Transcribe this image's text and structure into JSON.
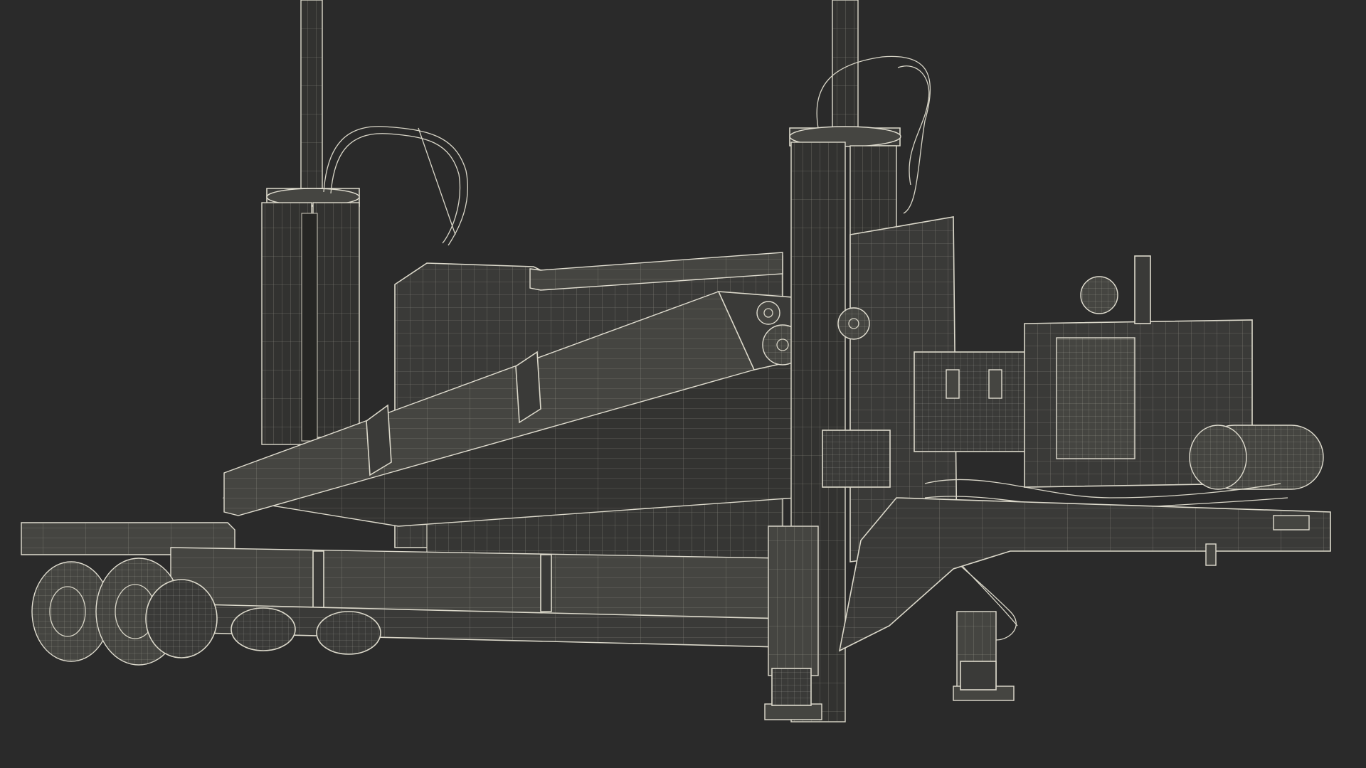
{
  "scene": {
    "subject": "",
    "background_color": "#2a2a2a",
    "wire_color": "#d9d6c8"
  }
}
